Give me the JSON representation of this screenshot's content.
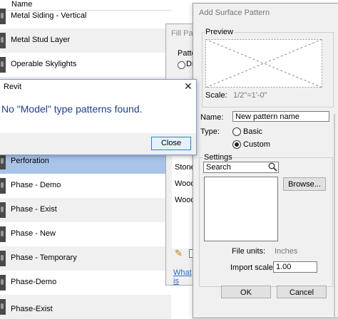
{
  "list": {
    "header": "Name",
    "rows": [
      {
        "label": "Metal Siding - Vertical"
      },
      {
        "label": "Metal Stud Layer"
      },
      {
        "label": "Operable Skylights"
      },
      {
        "label": ""
      },
      {
        "label": ""
      },
      {
        "label": ""
      },
      {
        "label": "Perforation"
      },
      {
        "label": "Phase - Demo"
      },
      {
        "label": "Phase - Exist"
      },
      {
        "label": "Phase - New"
      },
      {
        "label": "Phase - Temporary"
      },
      {
        "label": "Phase-Demo"
      },
      {
        "label": "Phase-Exist"
      }
    ]
  },
  "fill_patterns": {
    "title": "Fill Patt",
    "pattern_type_label": "Patter",
    "radio_label": "Dr",
    "items": [
      "Stone",
      "Wood",
      "Wood"
    ],
    "help_link": "What is"
  },
  "revit_dialog": {
    "title": "Revit",
    "message": "No \"Model\" type patterns found.",
    "close_button": "Close",
    "close_glyph": "✕"
  },
  "add_surface_pattern": {
    "title": "Add Surface Pattern",
    "preview_label": "Preview",
    "scale_label": "Scale:",
    "scale_value": "1/2\"=1'-0\"",
    "name_label": "Name:",
    "name_value": "New pattern name",
    "type_label": "Type:",
    "type_basic": "Basic",
    "type_custom": "Custom",
    "type_selected": "Custom",
    "settings_label": "Settings",
    "search_placeholder": "Search",
    "browse_button": "Browse...",
    "file_units_label": "File units:",
    "file_units_value": "Inches",
    "import_scale_label": "Import scale:",
    "import_scale_value": "1.00",
    "ok_button": "OK",
    "cancel_button": "Cancel"
  },
  "colors": {
    "selection": "#a9c3e9",
    "message_text": "#1f3e8a",
    "dialog_bg": "#f0f0f0",
    "accent_border": "#2c7fd6"
  }
}
